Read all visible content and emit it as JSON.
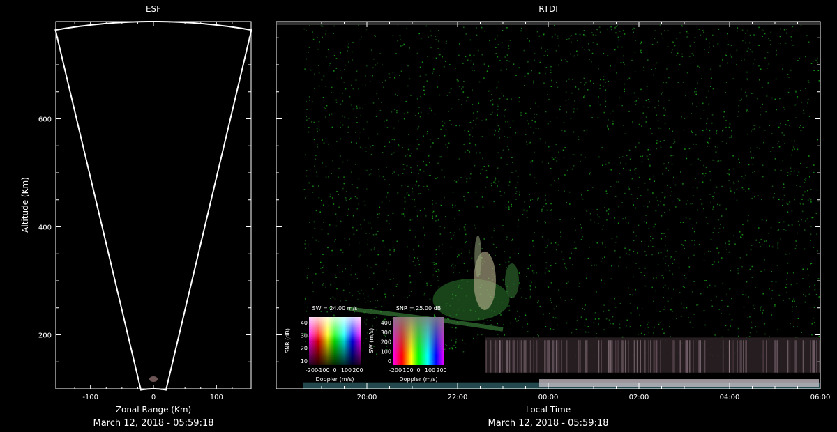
{
  "chart_data": [
    {
      "type": "area",
      "title": "ESF",
      "xlabel": "Zonal Range (Km)",
      "ylabel": "Altitude (Km)",
      "xlim": [
        -155,
        155
      ],
      "ylim": [
        100,
        780
      ],
      "x_ticks": [
        -100,
        0,
        100
      ],
      "y_ticks": [
        200,
        400,
        600
      ],
      "fan_outline": {
        "inner_radius_km": 100,
        "outer_radius_km": 780,
        "half_angle_deg": 11.5
      },
      "date_label": "March 12, 2018 - 05:59:18"
    },
    {
      "type": "heatmap",
      "title": "RTDI",
      "xlabel": "Local Time",
      "ylabel": "",
      "xlim_hours": [
        18.0,
        30.0
      ],
      "ylim": [
        100,
        780
      ],
      "x_ticks": [
        {
          "hour": 20,
          "label": "20:00"
        },
        {
          "hour": 22,
          "label": "22:00"
        },
        {
          "hour": 24,
          "label": "00:00"
        },
        {
          "hour": 26,
          "label": "02:00"
        },
        {
          "hour": 28,
          "label": "04:00"
        },
        {
          "hour": 30,
          "label": "06:00"
        }
      ],
      "date_label": "March 12, 2018 - 05:59:18",
      "colorbars": [
        {
          "title": "SW = 24.00 m/s",
          "xlabel": "Doppler (m/s)",
          "ylabel": "SNR (dB)",
          "x_ticks": [
            "-200",
            "-100",
            "0",
            "100",
            "200"
          ],
          "y_ticks": [
            "10",
            "20",
            "30",
            "40"
          ]
        },
        {
          "title": "SNR = 25.00 dB",
          "xlabel": "Doppler (m/s)",
          "ylabel": "SW (m/s)",
          "x_ticks": [
            "-200",
            "-100",
            "0",
            "100",
            "200"
          ],
          "y_ticks": [
            "0",
            "100",
            "200",
            "300",
            "400"
          ]
        }
      ]
    }
  ],
  "colors": {
    "background": "#000000",
    "axes": "#ffffff",
    "noise": "#1f6b1f",
    "echo_low": "#c9c0c8"
  }
}
